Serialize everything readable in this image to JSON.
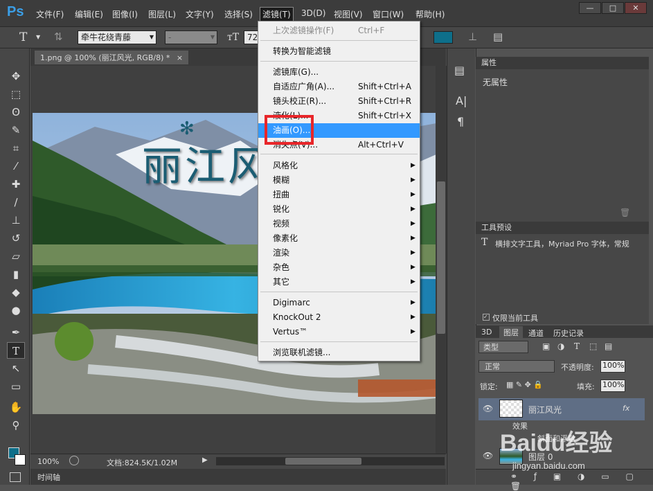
{
  "app": {
    "logo": "Ps"
  },
  "menubar": {
    "items": [
      "文件(F)",
      "编辑(E)",
      "图像(I)",
      "图层(L)",
      "文字(Y)",
      "选择(S)",
      "滤镜(T)",
      "3D(D)",
      "视图(V)",
      "窗口(W)",
      "帮助(H)"
    ],
    "window_buttons": [
      "—",
      "□",
      "✕"
    ]
  },
  "options": {
    "tool_glyph": "T",
    "font_family": "牵牛花绕青藤",
    "font_style": "-",
    "font_size": "72"
  },
  "document": {
    "tab_label": "1.png @ 100% (丽江风光, RGB/8) *",
    "tab_close": "×",
    "overlay_text": "丽江风",
    "zoom": "100%",
    "doc_info": "文档:824.5K/1.02M",
    "timeline_label": "时间轴"
  },
  "filter_menu": {
    "items": [
      {
        "label": "上次滤镜操作(F)",
        "shortcut": "Ctrl+F",
        "disabled": true
      },
      {
        "label": "转换为智能滤镜"
      },
      {
        "label": "滤镜库(G)..."
      },
      {
        "label": "自适应广角(A)...",
        "shortcut": "Shift+Ctrl+A"
      },
      {
        "label": "镜头校正(R)...",
        "shortcut": "Shift+Ctrl+R"
      },
      {
        "label": "液化(L)...",
        "shortcut": "Shift+Ctrl+X"
      },
      {
        "label": "油画(O)...",
        "highlighted": true
      },
      {
        "label": "消失点(V)...",
        "shortcut": "Alt+Ctrl+V"
      },
      {
        "label": "风格化",
        "submenu": true
      },
      {
        "label": "模糊",
        "submenu": true
      },
      {
        "label": "扭曲",
        "submenu": true
      },
      {
        "label": "锐化",
        "submenu": true
      },
      {
        "label": "视频",
        "submenu": true
      },
      {
        "label": "像素化",
        "submenu": true
      },
      {
        "label": "渲染",
        "submenu": true
      },
      {
        "label": "杂色",
        "submenu": true
      },
      {
        "label": "其它",
        "submenu": true
      },
      {
        "label": "Digimarc",
        "submenu": true
      },
      {
        "label": "KnockOut 2",
        "submenu": true
      },
      {
        "label": "Vertus™",
        "submenu": true
      },
      {
        "label": "浏览联机滤镜..."
      }
    ]
  },
  "properties_panel": {
    "title": "属性",
    "body": "无属性"
  },
  "tool_presets": {
    "title": "工具预设",
    "item": "横排文字工具，Myriad Pro 字体，常规",
    "checkbox_label": "仅限当前工具"
  },
  "layers_panel": {
    "tabs": [
      "3D",
      "图层",
      "通道",
      "历史记录"
    ],
    "filter_kind": "类型",
    "blend_mode": "正常",
    "opacity_label": "不透明度:",
    "opacity_value": "100%",
    "lock_label": "锁定:",
    "fill_label": "填充:",
    "fill_value": "100%",
    "layers": [
      {
        "name": "丽江风光",
        "fx": "fx",
        "effects_label": "效果",
        "effect_item": "斜面和浮雕"
      },
      {
        "name": "图层 0"
      }
    ]
  },
  "watermark": {
    "text": "Baidu经验",
    "url": "jingyan.baidu.com"
  },
  "colors": {
    "accent": "#3399ff",
    "red_box": "#e8262a",
    "ps_blue": "#3b9ee6",
    "foreground": "#0e6f8a"
  }
}
